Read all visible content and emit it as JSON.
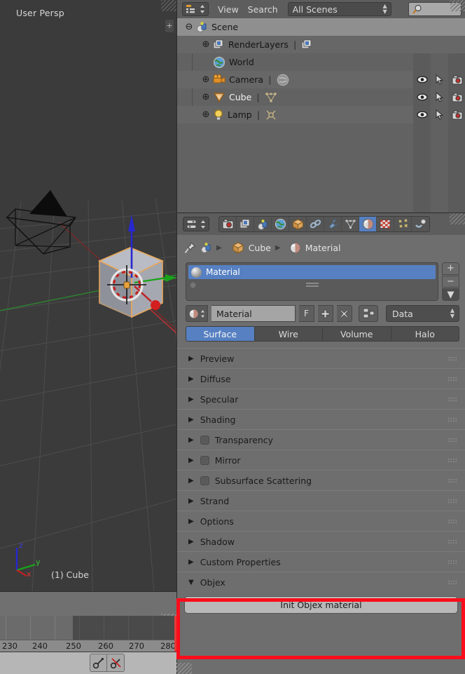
{
  "viewport": {
    "persp_label": "User Persp",
    "object_label": "(1) Cube",
    "axis": {
      "x": "x",
      "y": "y",
      "z": "z"
    },
    "plus_icon": "plus-icon",
    "grid_color": "#4a4a4a",
    "bg_color": "#3b3b3b"
  },
  "timeline": {
    "ticks": [
      "230",
      "240",
      "250",
      "260",
      "270",
      "280"
    ],
    "playhead_color": "#e23b3b"
  },
  "bottombar": {
    "buttons": [
      {
        "name": "bone-link-icon",
        "label": ""
      },
      {
        "name": "bone-unlink-icon",
        "label": ""
      }
    ]
  },
  "outliner": {
    "editor_type_icon": "outliner-editor-icon",
    "menus": [
      "View",
      "Search"
    ],
    "scene_filter": "All Scenes",
    "search_placeholder": "",
    "search_icon": "search-icon",
    "rows": [
      {
        "indent": 0,
        "twisty": "minus",
        "icon": "scene-icon",
        "label": "Scene",
        "selected": true,
        "white": false,
        "restrict": false
      },
      {
        "indent": 1,
        "twisty": "plus",
        "icon": "renderlayers-icon",
        "label": "RenderLayers",
        "sub_icon": "renderlayer-data-icon",
        "selected": false,
        "white": false,
        "restrict": false
      },
      {
        "indent": 1,
        "twisty": "none",
        "icon": "world-icon",
        "label": "World",
        "selected": false,
        "white": false,
        "restrict": false
      },
      {
        "indent": 1,
        "twisty": "plus",
        "icon": "camera-icon",
        "label": "Camera",
        "sub_icon": "camera-data-icon",
        "selected": false,
        "white": false,
        "restrict": true
      },
      {
        "indent": 1,
        "twisty": "plus",
        "icon": "mesh-object-icon",
        "label": "Cube",
        "sub_icon": "mesh-data-icon",
        "selected": false,
        "white": true,
        "restrict": true
      },
      {
        "indent": 1,
        "twisty": "plus",
        "icon": "lamp-icon",
        "label": "Lamp",
        "sub_icon": "lamp-data-icon",
        "selected": false,
        "white": false,
        "restrict": true
      }
    ],
    "restrict_columns": [
      "eye-icon",
      "cursor-arrow-icon",
      "camera-render-icon"
    ]
  },
  "properties": {
    "editor_type_icon": "properties-editor-icon",
    "tabs": [
      {
        "name": "tab-render",
        "icon": "camera-back-icon",
        "active": false
      },
      {
        "name": "tab-render-layers",
        "icon": "images-icon",
        "active": false
      },
      {
        "name": "tab-scene",
        "icon": "scene-icon",
        "active": false
      },
      {
        "name": "tab-world",
        "icon": "world-icon",
        "active": false
      },
      {
        "name": "tab-object",
        "icon": "cube-icon",
        "active": false
      },
      {
        "name": "tab-constraints",
        "icon": "chain-icon",
        "active": false
      },
      {
        "name": "tab-modifiers",
        "icon": "wrench-icon",
        "active": false
      },
      {
        "name": "tab-data",
        "icon": "mesh-triangle-icon",
        "active": false
      },
      {
        "name": "tab-material",
        "icon": "material-sphere-icon",
        "active": true
      },
      {
        "name": "tab-texture",
        "icon": "checker-icon",
        "active": false
      },
      {
        "name": "tab-particles",
        "icon": "particles-icon",
        "active": false
      },
      {
        "name": "tab-physics",
        "icon": "physics-icon",
        "active": false
      }
    ],
    "breadcrumb": {
      "pin_icon": "pin-icon",
      "scene_icon": "scene-icon",
      "items": [
        {
          "icon": "cube-icon",
          "label": "Cube"
        },
        {
          "icon": "material-sphere-icon",
          "label": "Material"
        }
      ]
    },
    "slot_list": {
      "slots": [
        {
          "label": "Material",
          "selected": true
        }
      ],
      "buttons": [
        {
          "name": "add-slot-button",
          "glyph": "+"
        },
        {
          "name": "remove-slot-button",
          "glyph": "−"
        },
        {
          "name": "slot-specials-button",
          "glyph": "▼"
        }
      ]
    },
    "datablock": {
      "icon": "material-sphere-icon",
      "name": "Material",
      "fake_user_label": "F",
      "new_label": "+",
      "unlink_label": "✕",
      "nodes_icon": "use-nodes-icon",
      "link_value": "Data"
    },
    "type_tabs": [
      {
        "label": "Surface",
        "active": true
      },
      {
        "label": "Wire",
        "active": false
      },
      {
        "label": "Volume",
        "active": false
      },
      {
        "label": "Halo",
        "active": false
      }
    ],
    "panels": [
      {
        "label": "Preview",
        "open": false,
        "checkbox": false
      },
      {
        "label": "Diffuse",
        "open": false,
        "checkbox": false
      },
      {
        "label": "Specular",
        "open": false,
        "checkbox": false
      },
      {
        "label": "Shading",
        "open": false,
        "checkbox": false
      },
      {
        "label": "Transparency",
        "open": false,
        "checkbox": true
      },
      {
        "label": "Mirror",
        "open": false,
        "checkbox": true
      },
      {
        "label": "Subsurface Scattering",
        "open": false,
        "checkbox": true
      },
      {
        "label": "Strand",
        "open": false,
        "checkbox": false
      },
      {
        "label": "Options",
        "open": false,
        "checkbox": false
      },
      {
        "label": "Shadow",
        "open": false,
        "checkbox": false
      },
      {
        "label": "Custom Properties",
        "open": false,
        "checkbox": false
      }
    ],
    "objex_panel": {
      "label": "Objex",
      "open": true,
      "button_label": "Init Objex material"
    }
  },
  "highlight": {
    "color": "#fb0d1b",
    "target": "objex-panel"
  }
}
